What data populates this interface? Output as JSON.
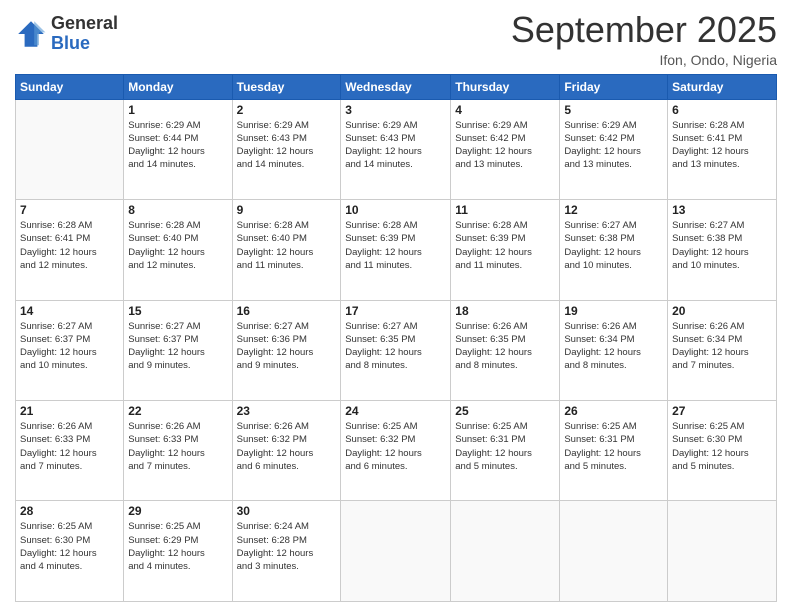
{
  "logo": {
    "general": "General",
    "blue": "Blue"
  },
  "title": "September 2025",
  "location": "Ifon, Ondo, Nigeria",
  "days_header": [
    "Sunday",
    "Monday",
    "Tuesday",
    "Wednesday",
    "Thursday",
    "Friday",
    "Saturday"
  ],
  "weeks": [
    [
      {
        "num": "",
        "info": ""
      },
      {
        "num": "1",
        "info": "Sunrise: 6:29 AM\nSunset: 6:44 PM\nDaylight: 12 hours\nand 14 minutes."
      },
      {
        "num": "2",
        "info": "Sunrise: 6:29 AM\nSunset: 6:43 PM\nDaylight: 12 hours\nand 14 minutes."
      },
      {
        "num": "3",
        "info": "Sunrise: 6:29 AM\nSunset: 6:43 PM\nDaylight: 12 hours\nand 14 minutes."
      },
      {
        "num": "4",
        "info": "Sunrise: 6:29 AM\nSunset: 6:42 PM\nDaylight: 12 hours\nand 13 minutes."
      },
      {
        "num": "5",
        "info": "Sunrise: 6:29 AM\nSunset: 6:42 PM\nDaylight: 12 hours\nand 13 minutes."
      },
      {
        "num": "6",
        "info": "Sunrise: 6:28 AM\nSunset: 6:41 PM\nDaylight: 12 hours\nand 13 minutes."
      }
    ],
    [
      {
        "num": "7",
        "info": "Sunrise: 6:28 AM\nSunset: 6:41 PM\nDaylight: 12 hours\nand 12 minutes."
      },
      {
        "num": "8",
        "info": "Sunrise: 6:28 AM\nSunset: 6:40 PM\nDaylight: 12 hours\nand 12 minutes."
      },
      {
        "num": "9",
        "info": "Sunrise: 6:28 AM\nSunset: 6:40 PM\nDaylight: 12 hours\nand 11 minutes."
      },
      {
        "num": "10",
        "info": "Sunrise: 6:28 AM\nSunset: 6:39 PM\nDaylight: 12 hours\nand 11 minutes."
      },
      {
        "num": "11",
        "info": "Sunrise: 6:28 AM\nSunset: 6:39 PM\nDaylight: 12 hours\nand 11 minutes."
      },
      {
        "num": "12",
        "info": "Sunrise: 6:27 AM\nSunset: 6:38 PM\nDaylight: 12 hours\nand 10 minutes."
      },
      {
        "num": "13",
        "info": "Sunrise: 6:27 AM\nSunset: 6:38 PM\nDaylight: 12 hours\nand 10 minutes."
      }
    ],
    [
      {
        "num": "14",
        "info": "Sunrise: 6:27 AM\nSunset: 6:37 PM\nDaylight: 12 hours\nand 10 minutes."
      },
      {
        "num": "15",
        "info": "Sunrise: 6:27 AM\nSunset: 6:37 PM\nDaylight: 12 hours\nand 9 minutes."
      },
      {
        "num": "16",
        "info": "Sunrise: 6:27 AM\nSunset: 6:36 PM\nDaylight: 12 hours\nand 9 minutes."
      },
      {
        "num": "17",
        "info": "Sunrise: 6:27 AM\nSunset: 6:35 PM\nDaylight: 12 hours\nand 8 minutes."
      },
      {
        "num": "18",
        "info": "Sunrise: 6:26 AM\nSunset: 6:35 PM\nDaylight: 12 hours\nand 8 minutes."
      },
      {
        "num": "19",
        "info": "Sunrise: 6:26 AM\nSunset: 6:34 PM\nDaylight: 12 hours\nand 8 minutes."
      },
      {
        "num": "20",
        "info": "Sunrise: 6:26 AM\nSunset: 6:34 PM\nDaylight: 12 hours\nand 7 minutes."
      }
    ],
    [
      {
        "num": "21",
        "info": "Sunrise: 6:26 AM\nSunset: 6:33 PM\nDaylight: 12 hours\nand 7 minutes."
      },
      {
        "num": "22",
        "info": "Sunrise: 6:26 AM\nSunset: 6:33 PM\nDaylight: 12 hours\nand 7 minutes."
      },
      {
        "num": "23",
        "info": "Sunrise: 6:26 AM\nSunset: 6:32 PM\nDaylight: 12 hours\nand 6 minutes."
      },
      {
        "num": "24",
        "info": "Sunrise: 6:25 AM\nSunset: 6:32 PM\nDaylight: 12 hours\nand 6 minutes."
      },
      {
        "num": "25",
        "info": "Sunrise: 6:25 AM\nSunset: 6:31 PM\nDaylight: 12 hours\nand 5 minutes."
      },
      {
        "num": "26",
        "info": "Sunrise: 6:25 AM\nSunset: 6:31 PM\nDaylight: 12 hours\nand 5 minutes."
      },
      {
        "num": "27",
        "info": "Sunrise: 6:25 AM\nSunset: 6:30 PM\nDaylight: 12 hours\nand 5 minutes."
      }
    ],
    [
      {
        "num": "28",
        "info": "Sunrise: 6:25 AM\nSunset: 6:30 PM\nDaylight: 12 hours\nand 4 minutes."
      },
      {
        "num": "29",
        "info": "Sunrise: 6:25 AM\nSunset: 6:29 PM\nDaylight: 12 hours\nand 4 minutes."
      },
      {
        "num": "30",
        "info": "Sunrise: 6:24 AM\nSunset: 6:28 PM\nDaylight: 12 hours\nand 3 minutes."
      },
      {
        "num": "",
        "info": ""
      },
      {
        "num": "",
        "info": ""
      },
      {
        "num": "",
        "info": ""
      },
      {
        "num": "",
        "info": ""
      }
    ]
  ]
}
